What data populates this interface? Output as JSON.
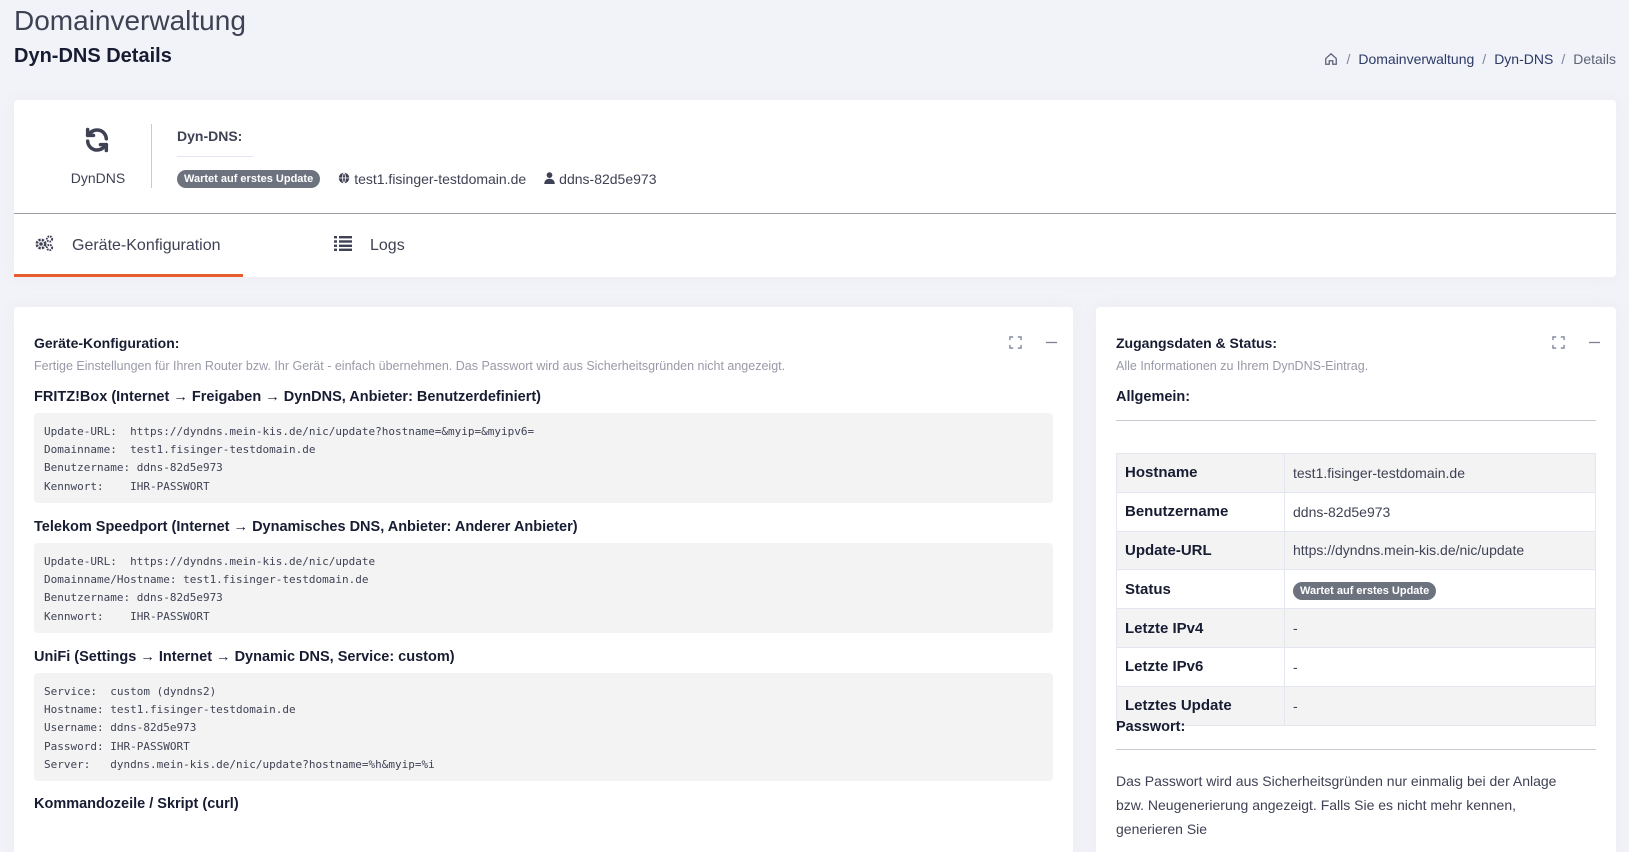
{
  "header": {
    "title": "Domainverwaltung",
    "subtitle": "Dyn-DNS Details",
    "breadcrumb": {
      "home_icon": "home-icon",
      "items": [
        "Domainverwaltung",
        "Dyn-DNS",
        "Details"
      ]
    }
  },
  "summary": {
    "icon": "refresh-icon",
    "icon_label": "DynDNS",
    "title": "Dyn-DNS:",
    "badge": "Wartet auf erstes Update",
    "hostname": "test1.fisinger-testdomain.de",
    "username": "ddns-82d5e973"
  },
  "tabs": [
    {
      "label": "Geräte-Konfiguration",
      "icon": "cogs-icon",
      "active": true
    },
    {
      "label": "Logs",
      "icon": "list-icon",
      "active": false
    }
  ],
  "config_panel": {
    "title": "Geräte-Konfiguration:",
    "description": "Fertige Einstellungen für Ihren Router bzw. Ihr Gerät - einfach übernehmen. Das Passwort wird aus Sicherheitsgründen nicht angezeigt.",
    "sections": [
      {
        "heading": "FRITZ!Box (Internet → Freigaben → DynDNS, Anbieter: Benutzerdefiniert)",
        "code": "Update-URL:  https://dyndns.mein-kis.de/nic/update?hostname=&myip=&myipv6=\nDomainname:  test1.fisinger-testdomain.de\nBenutzername: ddns-82d5e973\nKennwort:    IHR-PASSWORT"
      },
      {
        "heading": "Telekom Speedport (Internet → Dynamisches DNS, Anbieter: Anderer Anbieter)",
        "code": "Update-URL:  https://dyndns.mein-kis.de/nic/update\nDomainname/Hostname: test1.fisinger-testdomain.de\nBenutzername: ddns-82d5e973\nKennwort:    IHR-PASSWORT"
      },
      {
        "heading": "UniFi (Settings → Internet → Dynamic DNS, Service: custom)",
        "code": "Service:  custom (dyndns2)\nHostname: test1.fisinger-testdomain.de\nUsername: ddns-82d5e973\nPassword: IHR-PASSWORT\nServer:   dyndns.mein-kis.de/nic/update?hostname=%h&myip=%i"
      },
      {
        "heading": "Kommandozeile / Skript (curl)",
        "code": ""
      }
    ]
  },
  "status_panel": {
    "title": "Zugangsdaten & Status:",
    "description": "Alle Informationen zu Ihrem DynDNS-Eintrag.",
    "general_heading": "Allgemein:",
    "rows": [
      {
        "key": "Hostname",
        "value": "test1.fisinger-testdomain.de"
      },
      {
        "key": "Benutzername",
        "value": "ddns-82d5e973"
      },
      {
        "key": "Update-URL",
        "value": "https://dyndns.mein-kis.de/nic/update"
      },
      {
        "key": "Status",
        "value": "Wartet auf erstes Update"
      },
      {
        "key": "Letzte IPv4",
        "value": "-"
      },
      {
        "key": "Letzte IPv6",
        "value": "-"
      },
      {
        "key": "Letztes Update",
        "value": "-"
      }
    ],
    "password_heading": "Passwort:",
    "password_text": "Das Passwort wird aus Sicherheitsgründen nur einmalig bei der Anlage bzw. Neugenerierung angezeigt. Falls Sie es nicht mehr kennen, generieren Sie"
  },
  "colors": {
    "accent": "#e85d2e",
    "badge": "#6c737f",
    "background": "#f2f3f8"
  }
}
